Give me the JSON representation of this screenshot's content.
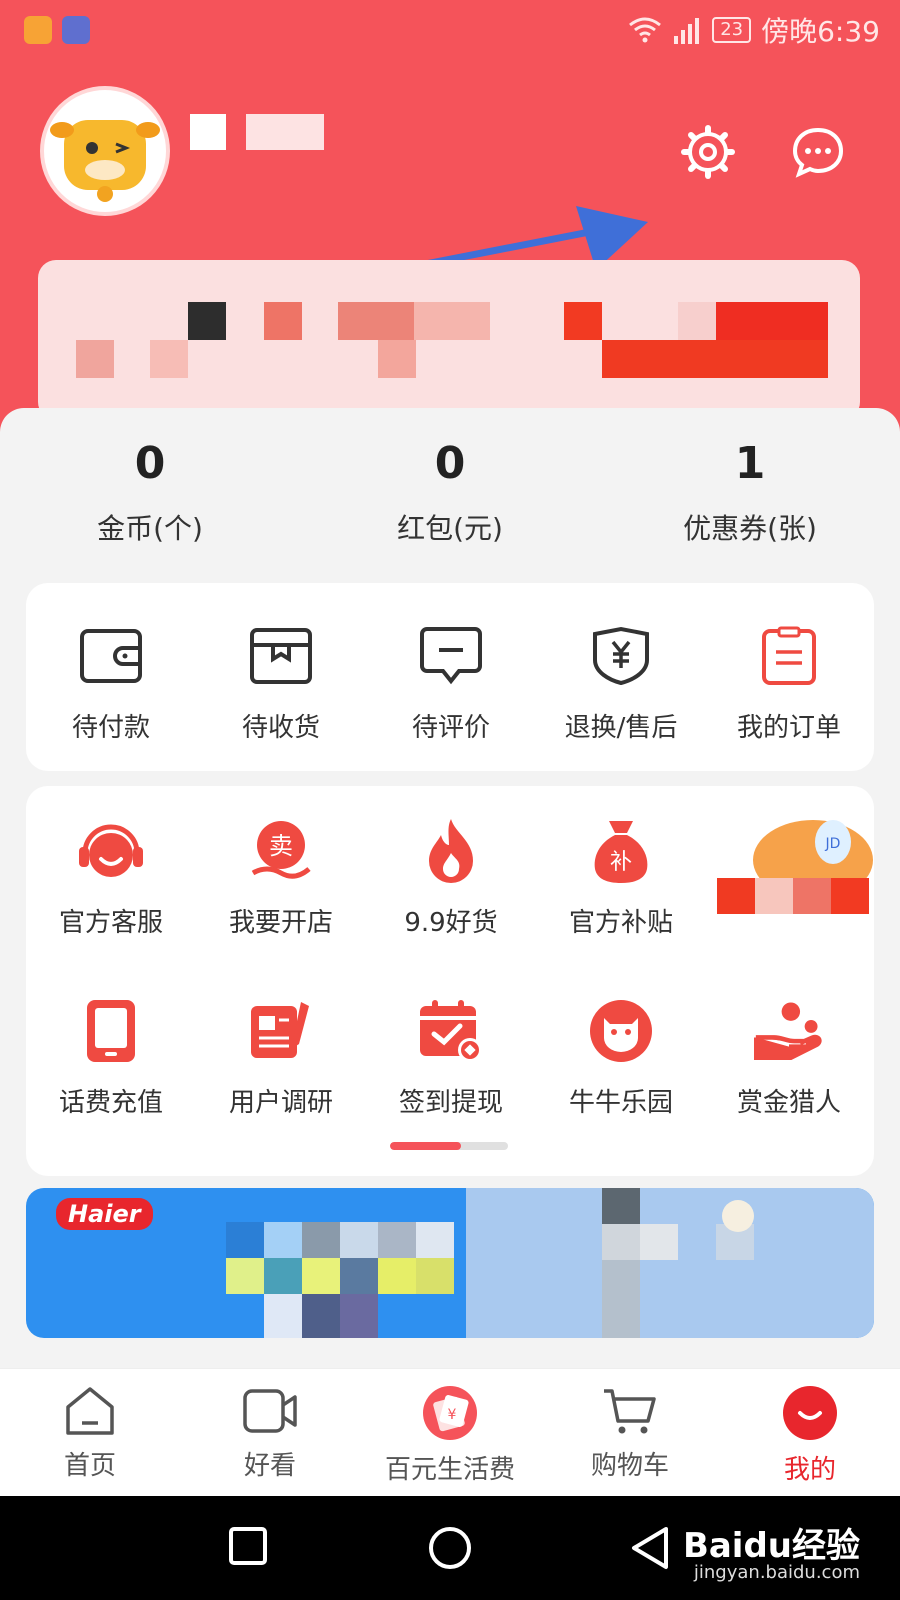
{
  "status_bar": {
    "battery": "23",
    "time": "傍晚6:39"
  },
  "stats": [
    {
      "value": "0",
      "label": "金币(个)"
    },
    {
      "value": "0",
      "label": "红包(元)"
    },
    {
      "value": "1",
      "label": "优惠券(张)"
    }
  ],
  "orders": [
    {
      "label": "待付款",
      "icon": "wallet-icon"
    },
    {
      "label": "待收货",
      "icon": "box-icon"
    },
    {
      "label": "待评价",
      "icon": "comment-icon"
    },
    {
      "label": "退换/售后",
      "icon": "refund-icon"
    },
    {
      "label": "我的订单",
      "icon": "order-list-icon"
    }
  ],
  "services": [
    {
      "label": "官方客服",
      "icon": "headset-icon"
    },
    {
      "label": "我要开店",
      "icon": "open-shop-icon"
    },
    {
      "label": "9.9好货",
      "icon": "fire-icon"
    },
    {
      "label": "官方补贴",
      "icon": "money-bag-icon"
    },
    {
      "label": "话费充值",
      "icon": "phone-icon"
    },
    {
      "label": "用户调研",
      "icon": "survey-icon"
    },
    {
      "label": "签到提现",
      "icon": "calendar-check-icon"
    },
    {
      "label": "牛牛乐园",
      "icon": "cow-icon"
    },
    {
      "label": "赏金猎人",
      "icon": "bounty-hand-icon"
    }
  ],
  "ad": {
    "brand": "Haier"
  },
  "tabs": [
    {
      "label": "首页",
      "icon": "home-icon"
    },
    {
      "label": "好看",
      "icon": "video-icon"
    },
    {
      "label": "百元生活费",
      "icon": "red-envelope-icon"
    },
    {
      "label": "购物车",
      "icon": "cart-icon"
    },
    {
      "label": "我的",
      "icon": "profile-icon",
      "active": true
    }
  ],
  "watermark": {
    "main": "Baidu经验",
    "sub": "jingyan.baidu.com"
  },
  "colors": {
    "primary": "#f5535a",
    "active_tab": "#e8262d",
    "icon_red": "#ef4a41"
  }
}
